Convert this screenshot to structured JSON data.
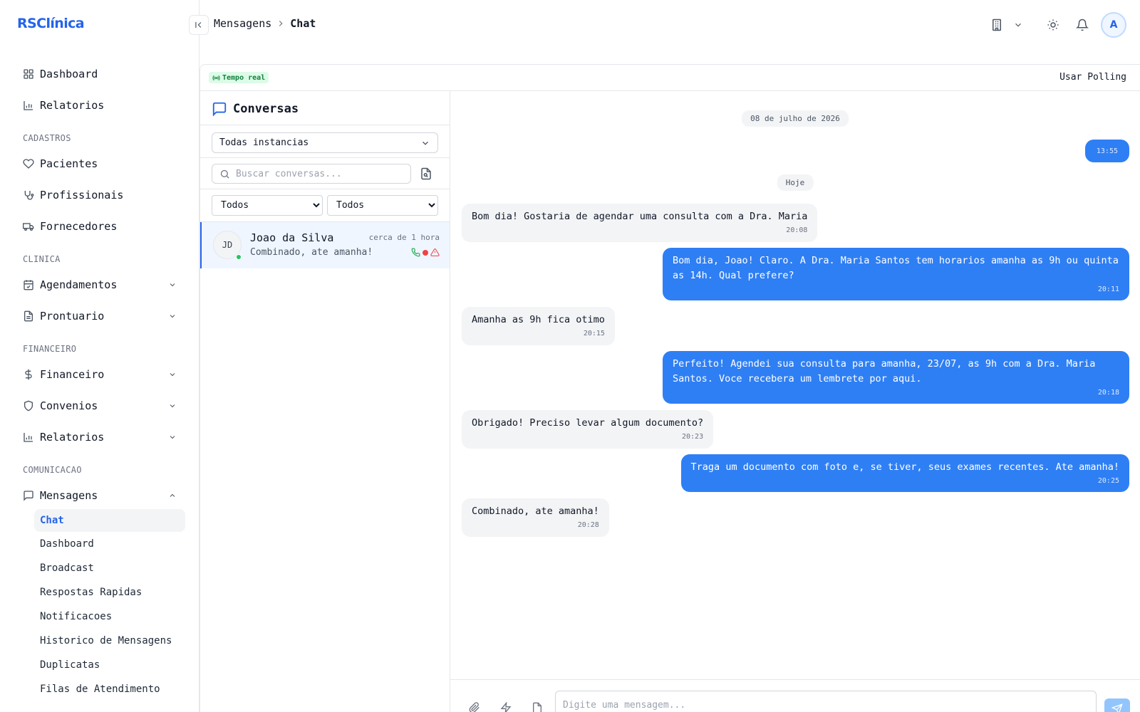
{
  "app": {
    "logo": "RSClínica"
  },
  "sidebar": {
    "top_items": [
      {
        "label": "Dashboard"
      },
      {
        "label": "Relatorios"
      }
    ],
    "sections": {
      "cadastros": "CADASTROS",
      "clinica": "CLINICA",
      "financeiro": "FINANCEIRO",
      "comunicacao": "COMUNICACAO"
    },
    "cadastros_items": [
      {
        "label": "Pacientes"
      },
      {
        "label": "Profissionais"
      },
      {
        "label": "Fornecedores"
      }
    ],
    "clinica_items": [
      {
        "label": "Agendamentos"
      },
      {
        "label": "Prontuario"
      }
    ],
    "financeiro_items": [
      {
        "label": "Financeiro"
      },
      {
        "label": "Convenios"
      },
      {
        "label": "Relatorios"
      }
    ],
    "mensagens": {
      "label": "Mensagens",
      "sub_items": [
        {
          "label": "Chat",
          "active": true
        },
        {
          "label": "Dashboard"
        },
        {
          "label": "Broadcast"
        },
        {
          "label": "Respostas Rapidas"
        },
        {
          "label": "Notificacoes"
        },
        {
          "label": "Historico de Mensagens"
        },
        {
          "label": "Duplicatas"
        },
        {
          "label": "Filas de Atendimento"
        }
      ]
    }
  },
  "header": {
    "breadcrumb": [
      "Mensagens",
      "Chat"
    ],
    "avatar_initial": "A"
  },
  "topbar": {
    "realtime_label": "Tempo real",
    "polling_label": "Usar Polling"
  },
  "conversations": {
    "title": "Conversas",
    "instance_select": "Todas instancias",
    "search_placeholder": "Buscar conversas...",
    "filters": [
      {
        "selected": "Todos"
      },
      {
        "selected": "Todos"
      }
    ],
    "items": [
      {
        "initials": "JD",
        "name": "Joao da Silva",
        "time": "cerca de 1 hora",
        "preview": "Combinado, ate amanha!"
      }
    ]
  },
  "chat": {
    "date_separators": [
      "08 de julho de 2026",
      "Hoje"
    ],
    "messages": [
      {
        "direction": "out",
        "text": "",
        "time": "13:55"
      },
      {
        "direction": "in",
        "text": "Bom dia! Gostaria de agendar uma consulta com a Dra. Maria",
        "time": "20:08"
      },
      {
        "direction": "out",
        "text": "Bom dia, Joao! Claro. A Dra. Maria Santos tem horarios amanha as 9h ou quinta as 14h. Qual prefere?",
        "time": "20:11"
      },
      {
        "direction": "in",
        "text": "Amanha as 9h fica otimo",
        "time": "20:15"
      },
      {
        "direction": "out",
        "text": "Perfeito! Agendei sua consulta para amanha, 23/07, as 9h com a Dra. Maria Santos. Voce recebera um lembrete por aqui.",
        "time": "20:18"
      },
      {
        "direction": "in",
        "text": "Obrigado! Preciso levar algum documento?",
        "time": "20:23"
      },
      {
        "direction": "out",
        "text": "Traga um documento com foto e, se tiver, seus exames recentes. Ate amanha!",
        "time": "20:25"
      },
      {
        "direction": "in",
        "text": "Combinado, ate amanha!",
        "time": "20:28"
      }
    ],
    "composer_placeholder": "Digite uma mensagem..."
  },
  "colors": {
    "accent": "#2563eb",
    "outgoing_bubble": "#2f7ff4",
    "incoming_bubble": "#f3f4f6",
    "realtime_badge": "#dcfce7",
    "online": "#22c55e"
  }
}
